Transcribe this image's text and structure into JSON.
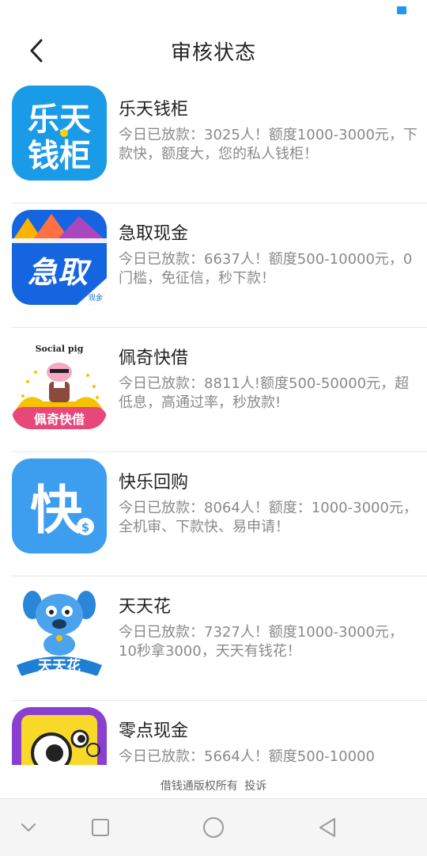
{
  "header": {
    "title": "审核状态"
  },
  "apps": [
    {
      "name": "乐天钱柜",
      "desc": "今日已放款：3025人！额度1000-3000元，下款快，额度大，您的私人钱柜！",
      "icon_text": "乐天钱柜"
    },
    {
      "name": "急取现金",
      "desc": "今日已放款：6637人！额度500-10000元，0门槛，免征信，秒下款！",
      "icon_text": "急取"
    },
    {
      "name": "佩奇快借",
      "desc": "今日已放款：8811人!额度500-50000元，超低息，高通过率，秒放款!",
      "icon_text": "佩奇快借",
      "icon_caption": "Social pig"
    },
    {
      "name": "快乐回购",
      "desc": "今日已放款：8064人！额度：1000-3000元，全机审、下款快、易申请！",
      "icon_text": "快"
    },
    {
      "name": "天天花",
      "desc": "今日已放款：7327人！额度1000-3000元，10秒拿3000，天天有钱花！",
      "icon_text": "天天花"
    },
    {
      "name": "零点现金",
      "desc": "今日已放款：5664人！额度500-10000",
      "icon_text": ""
    }
  ],
  "footer": {
    "copyright": "借钱通版权所有",
    "complaint": "投诉"
  },
  "colors": {
    "accent": "#2196f3"
  }
}
